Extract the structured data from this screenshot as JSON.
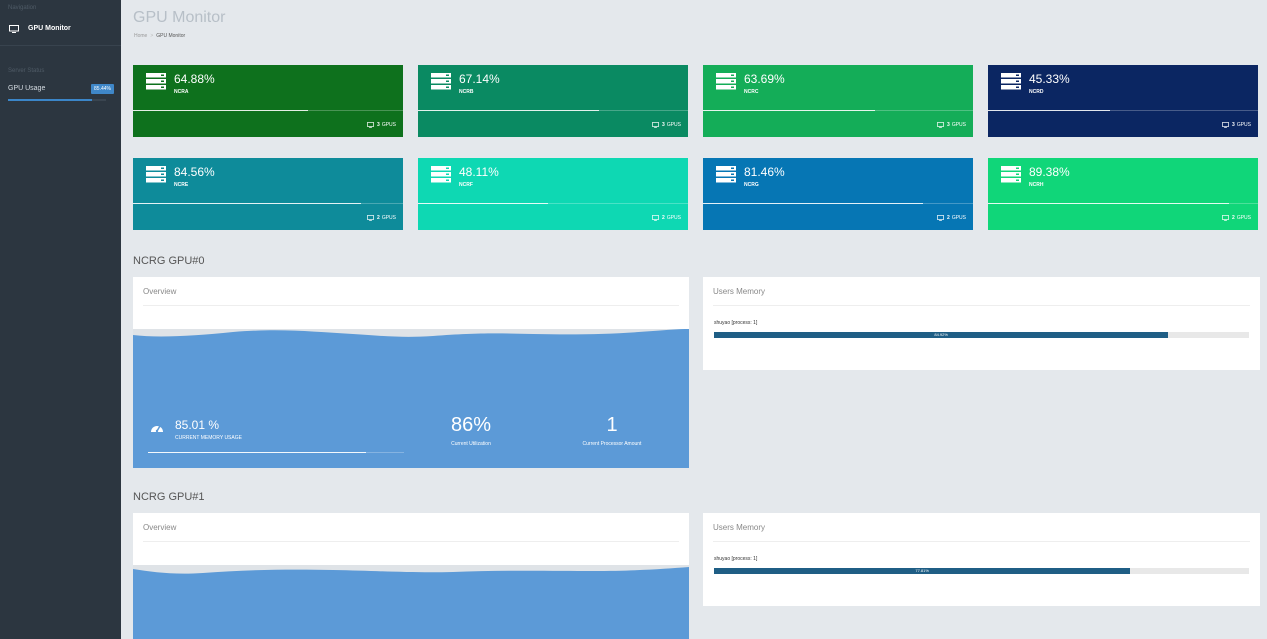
{
  "sidebar": {
    "nav_header": "Navigation",
    "nav_item": "GPU Monitor",
    "status_header": "Server Status",
    "gpu_usage_label": "GPU Usage",
    "gpu_usage_value": "85.44%",
    "gpu_usage_fraction": 0.8544,
    "icon": "monitor-icon"
  },
  "header": {
    "title": "GPU Monitor",
    "breadcrumb": [
      "Home",
      "GPU Monitor"
    ]
  },
  "servers": [
    {
      "pct": "64.88%",
      "name": "NCRA",
      "gpus": "3",
      "gpus_label": "GPUS",
      "fill": 0.6488,
      "color": "#0e711d"
    },
    {
      "pct": "67.14%",
      "name": "NCRB",
      "gpus": "3",
      "gpus_label": "GPUS",
      "fill": 0.6714,
      "color": "#0a8a62"
    },
    {
      "pct": "63.69%",
      "name": "NCRC",
      "gpus": "3",
      "gpus_label": "GPUS",
      "fill": 0.6369,
      "color": "#14ad58"
    },
    {
      "pct": "45.33%",
      "name": "NCRD",
      "gpus": "3",
      "gpus_label": "GPUS",
      "fill": 0.4533,
      "color": "#0b2662"
    },
    {
      "pct": "84.56%",
      "name": "NCRE",
      "gpus": "2",
      "gpus_label": "GPUS",
      "fill": 0.8456,
      "color": "#0e8b9a"
    },
    {
      "pct": "48.11%",
      "name": "NCRF",
      "gpus": "2",
      "gpus_label": "GPUS",
      "fill": 0.4811,
      "color": "#0ed8b3"
    },
    {
      "pct": "81.46%",
      "name": "NCRG",
      "gpus": "2",
      "gpus_label": "GPUS",
      "fill": 0.8146,
      "color": "#0676b4"
    },
    {
      "pct": "89.38%",
      "name": "NCRH",
      "gpus": "2",
      "gpus_label": "GPUS",
      "fill": 0.8938,
      "color": "#10d679"
    }
  ],
  "server_icon": "server-icon",
  "gpu0": {
    "title": "NCRG GPU#0",
    "overview_title": "Overview",
    "users_title": "Users Memory",
    "mem_usage": "85.01 %",
    "mem_usage_fraction": 0.8501,
    "mem_label": "CURRENT MEMORY USAGE",
    "utilization": "86%",
    "utilization_label": "Current Utilization",
    "processes": "1",
    "processes_label": "Current Processor Amount",
    "user": "shuyao [process: 1]",
    "user_mem": "84.92%",
    "user_mem_fraction": 0.8492,
    "gauge_icon": "gauge-icon"
  },
  "gpu1": {
    "title": "NCRG GPU#1",
    "overview_title": "Overview",
    "users_title": "Users Memory",
    "user": "shuyao [process: 1]",
    "user_mem": "77.81%",
    "user_mem_fraction": 0.7781
  },
  "colors": {
    "sidebar": "#2c3640",
    "background": "#e4e8ec",
    "accent": "#3b86c9",
    "area": "#5c9ad7",
    "memory_bar": "#1f5e85"
  }
}
